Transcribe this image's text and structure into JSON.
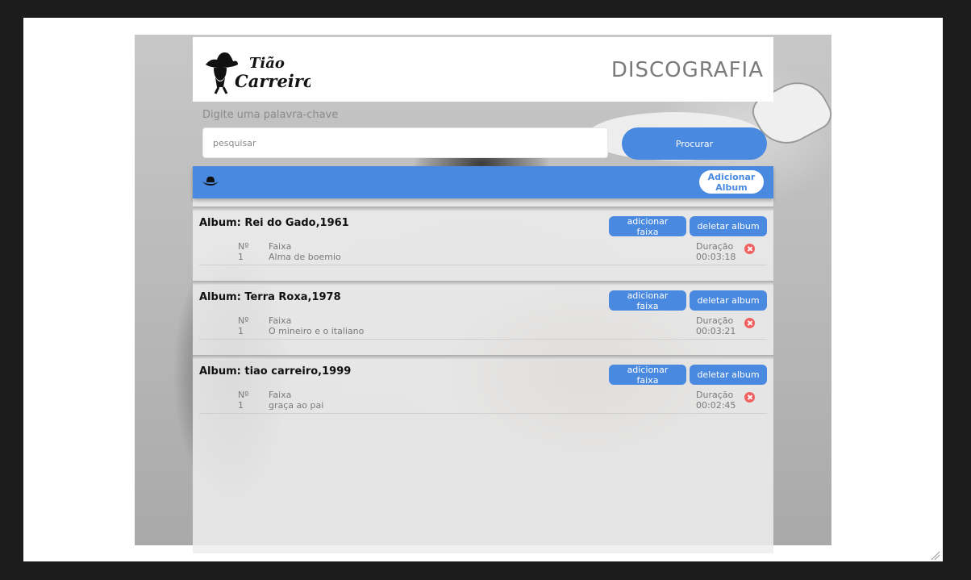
{
  "header": {
    "logo_text": "Tião Carreiro",
    "title": "DISCOGRAFIA"
  },
  "search": {
    "label": "Digite uma palavra-chave",
    "placeholder": "pesquisar",
    "value": "",
    "button_label": "Procurar"
  },
  "toolbar": {
    "icon": "cowboy-hat-icon",
    "add_album_line1": "Adicionar",
    "add_album_line2": "Album"
  },
  "columns": {
    "number": "Nº",
    "track": "Faixa",
    "duration": "Duração"
  },
  "albums": [
    {
      "title": "Album: Rei do Gado,1961",
      "add_track_label": "adicionar faixa",
      "delete_label": "deletar album",
      "tracks": [
        {
          "number": "1",
          "name": "Alma de boemio",
          "duration": "00:03:18"
        }
      ]
    },
    {
      "title": "Album: Terra Roxa,1978",
      "add_track_label": "adicionar faixa",
      "delete_label": "deletar album",
      "tracks": [
        {
          "number": "1",
          "name": "O mineiro e o italiano",
          "duration": "00:03:21"
        }
      ]
    },
    {
      "title": "Album: tiao carreiro,1999",
      "add_track_label": "adicionar faixa",
      "delete_label": "deletar album",
      "tracks": [
        {
          "number": "1",
          "name": "graça ao pai",
          "duration": "00:02:45"
        }
      ]
    }
  ],
  "colors": {
    "accent": "#4a89e0",
    "delete": "#f06262",
    "window_frame": "#1c1c1c"
  }
}
